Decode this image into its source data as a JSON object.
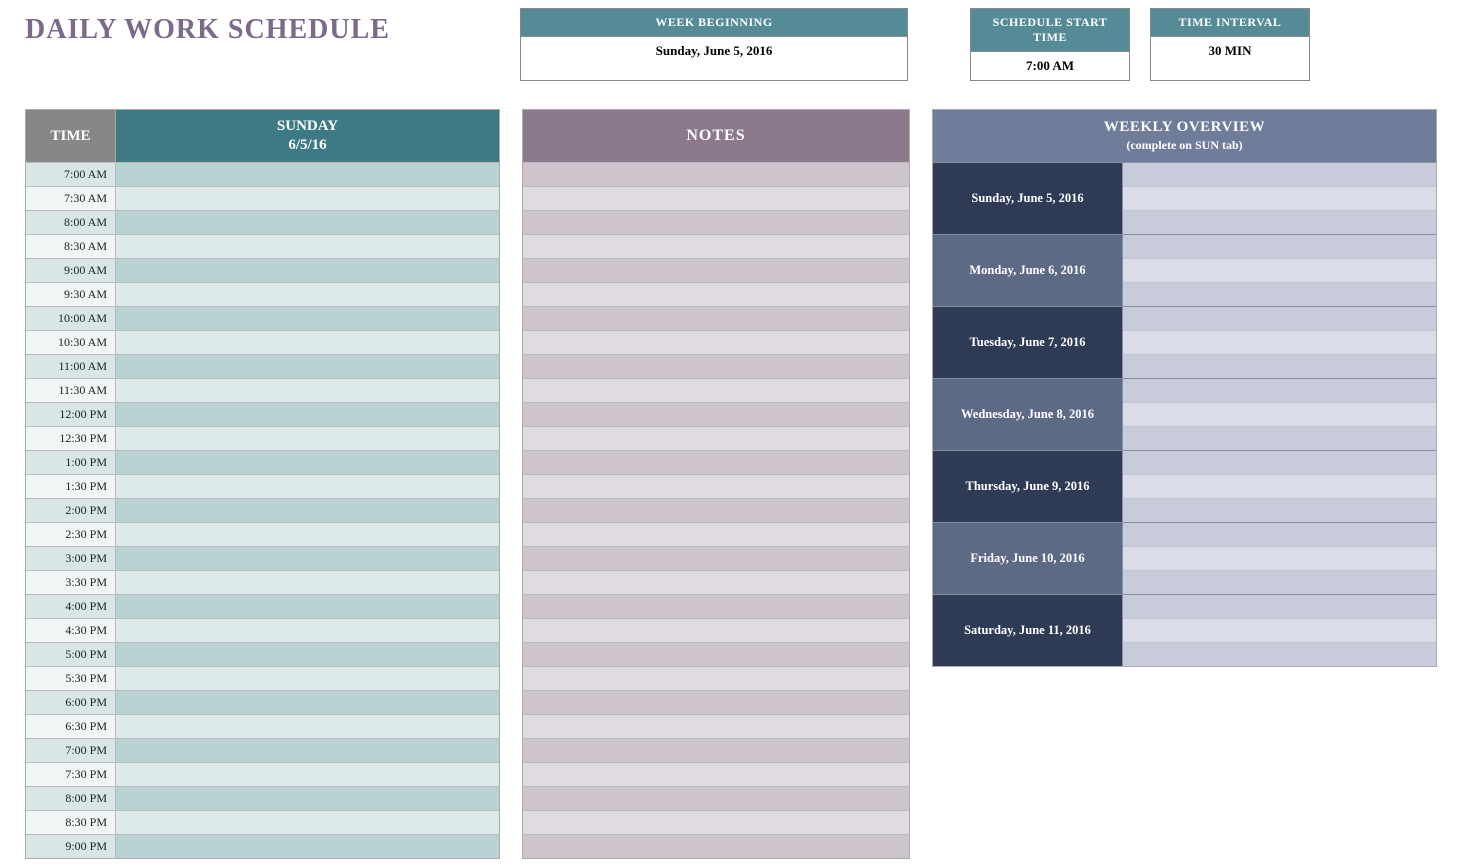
{
  "title": "DAILY WORK SCHEDULE",
  "info": {
    "week_beginning_label": "WEEK BEGINNING",
    "week_beginning_value": "Sunday, June 5, 2016",
    "start_time_label": "SCHEDULE START TIME",
    "start_time_value": "7:00 AM",
    "interval_label": "TIME INTERVAL",
    "interval_value": "30 MIN"
  },
  "schedule": {
    "time_header": "TIME",
    "day_header_line1": "SUNDAY",
    "day_header_line2": "6/5/16",
    "rows": [
      {
        "time": "7:00 AM",
        "value": ""
      },
      {
        "time": "7:30 AM",
        "value": ""
      },
      {
        "time": "8:00 AM",
        "value": ""
      },
      {
        "time": "8:30 AM",
        "value": ""
      },
      {
        "time": "9:00 AM",
        "value": ""
      },
      {
        "time": "9:30 AM",
        "value": ""
      },
      {
        "time": "10:00 AM",
        "value": ""
      },
      {
        "time": "10:30 AM",
        "value": ""
      },
      {
        "time": "11:00 AM",
        "value": ""
      },
      {
        "time": "11:30 AM",
        "value": ""
      },
      {
        "time": "12:00 PM",
        "value": ""
      },
      {
        "time": "12:30 PM",
        "value": ""
      },
      {
        "time": "1:00 PM",
        "value": ""
      },
      {
        "time": "1:30 PM",
        "value": ""
      },
      {
        "time": "2:00 PM",
        "value": ""
      },
      {
        "time": "2:30 PM",
        "value": ""
      },
      {
        "time": "3:00 PM",
        "value": ""
      },
      {
        "time": "3:30 PM",
        "value": ""
      },
      {
        "time": "4:00 PM",
        "value": ""
      },
      {
        "time": "4:30 PM",
        "value": ""
      },
      {
        "time": "5:00 PM",
        "value": ""
      },
      {
        "time": "5:30 PM",
        "value": ""
      },
      {
        "time": "6:00 PM",
        "value": ""
      },
      {
        "time": "6:30 PM",
        "value": ""
      },
      {
        "time": "7:00 PM",
        "value": ""
      },
      {
        "time": "7:30 PM",
        "value": ""
      },
      {
        "time": "8:00 PM",
        "value": ""
      },
      {
        "time": "8:30 PM",
        "value": ""
      },
      {
        "time": "9:00 PM",
        "value": ""
      }
    ]
  },
  "notes": {
    "header": "NOTES",
    "row_count": 29
  },
  "overview": {
    "header_line1": "WEEKLY OVERVIEW",
    "header_line2": "(complete on SUN tab)",
    "days": [
      {
        "label": "Sunday, June 5, 2016"
      },
      {
        "label": "Monday, June 6, 2016"
      },
      {
        "label": "Tuesday, June 7, 2016"
      },
      {
        "label": "Wednesday, June 8, 2016"
      },
      {
        "label": "Thursday, June 9, 2016"
      },
      {
        "label": "Friday, June 10, 2016"
      },
      {
        "label": "Saturday, June 11, 2016"
      }
    ]
  }
}
